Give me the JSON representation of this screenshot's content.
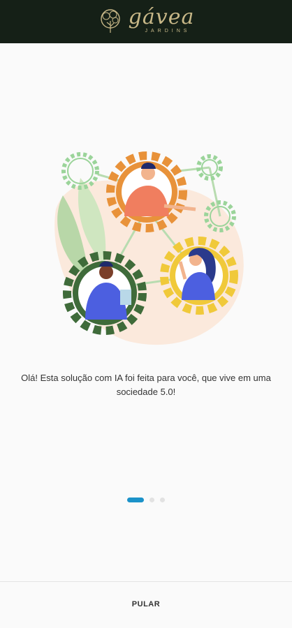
{
  "header": {
    "logo_main": "gávea",
    "logo_sub": "JARDINS"
  },
  "onboarding": {
    "message": "Olá! Esta solução com IA foi feita para você, que vive em uma sociedade 5.0!",
    "page_indicator": {
      "current": 1,
      "total": 3
    }
  },
  "footer": {
    "skip_label": "PULAR"
  },
  "colors": {
    "header_bg": "#152017",
    "logo": "#c8b888",
    "accent": "#1b92c9",
    "gear_orange": "#e8923a",
    "gear_green_dark": "#3f6b3a",
    "gear_yellow": "#f0c93a",
    "gear_light_green": "#9bd49a"
  },
  "icons": [
    "tree-logo-icon",
    "teamwork-gears-illustration"
  ]
}
